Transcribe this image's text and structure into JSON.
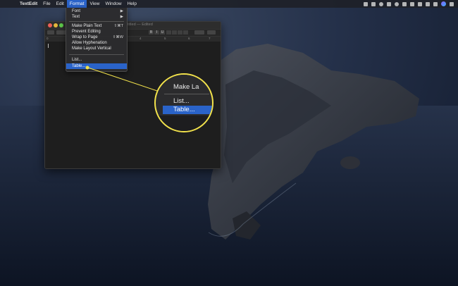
{
  "menubar": {
    "app_name": "TextEdit",
    "items": [
      "File",
      "Edit",
      "Format",
      "View",
      "Window",
      "Help"
    ]
  },
  "window": {
    "title": "Untitled — Edited"
  },
  "format_menu": {
    "items": [
      {
        "label": "Font",
        "shortcut": "▶"
      },
      {
        "label": "Text",
        "shortcut": "▶"
      },
      {
        "label": "Make Plain Text",
        "shortcut": "⇧⌘T"
      },
      {
        "label": "Prevent Editing",
        "shortcut": ""
      },
      {
        "label": "Wrap to Page",
        "shortcut": "⇧⌘W"
      },
      {
        "label": "Allow Hyphenation",
        "shortcut": ""
      },
      {
        "label": "Make Layout Vertical",
        "shortcut": ""
      },
      {
        "label": "List...",
        "shortcut": ""
      },
      {
        "label": "Table...",
        "shortcut": ""
      }
    ],
    "highlighted": "Table..."
  },
  "zoom": {
    "make_label": "Make La",
    "list_label": "List...",
    "table_label": "Table..."
  },
  "colors": {
    "highlight": "#2a63c9",
    "callout": "#f2e24b"
  }
}
